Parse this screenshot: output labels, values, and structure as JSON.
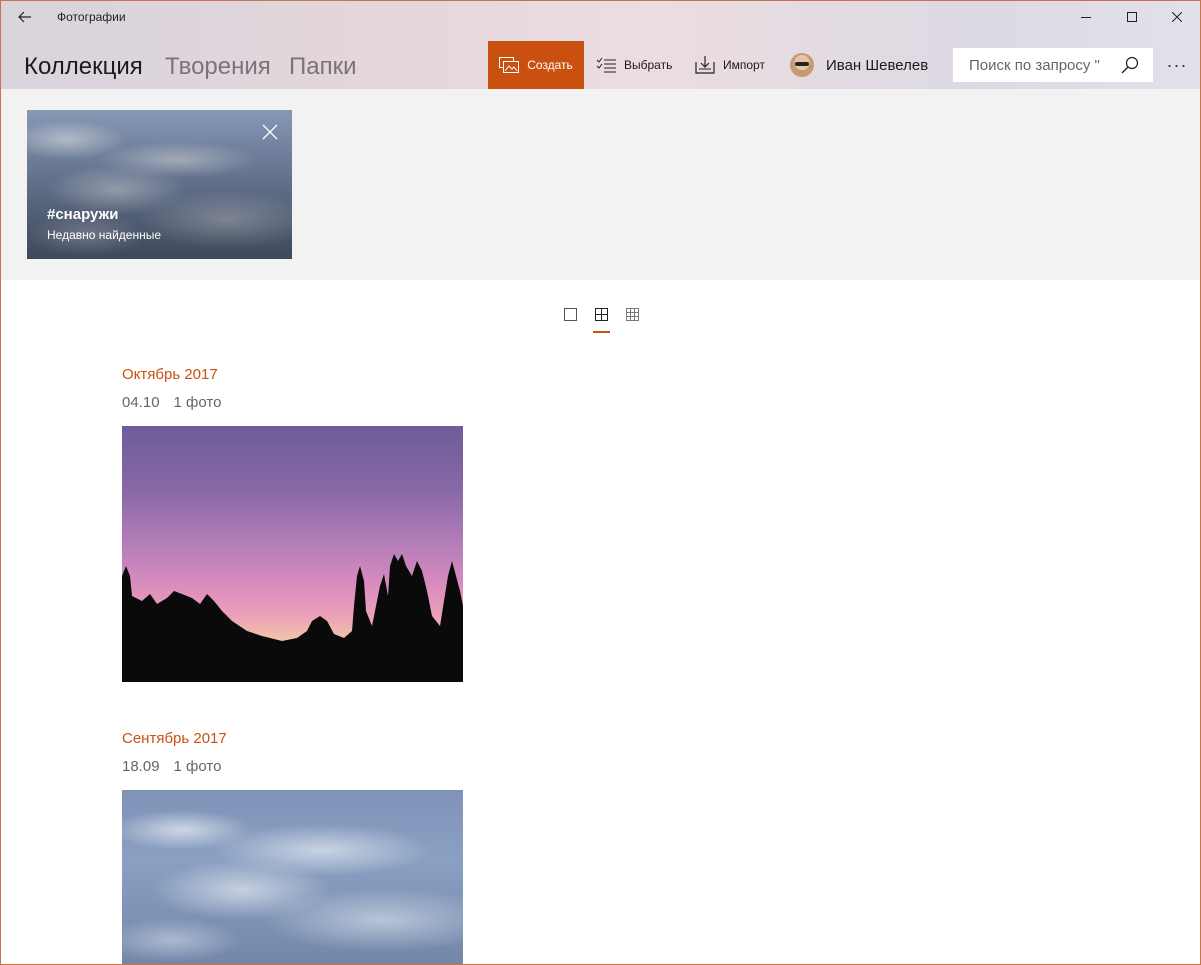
{
  "app": {
    "title": "Фотографии"
  },
  "nav": {
    "tabs": [
      {
        "label": "Коллекция",
        "active": true
      },
      {
        "label": "Творения",
        "active": false
      },
      {
        "label": "Папки",
        "active": false
      }
    ]
  },
  "toolbar": {
    "create_label": "Создать",
    "select_label": "Выбрать",
    "import_label": "Импорт",
    "user_name": "Иван Шевелев",
    "more_label": "···"
  },
  "search": {
    "placeholder": "Поиск по запросу \""
  },
  "tag_card": {
    "title": "#снаружи",
    "subtitle": "Недавно найденные"
  },
  "view_modes": {
    "active": "medium"
  },
  "groups": [
    {
      "title": "Октябрь 2017",
      "date": "04.10",
      "count": "1 фото"
    },
    {
      "title": "Сентябрь 2017",
      "date": "18.09",
      "count": "1 фото"
    }
  ],
  "colors": {
    "accent": "#ca5010"
  }
}
